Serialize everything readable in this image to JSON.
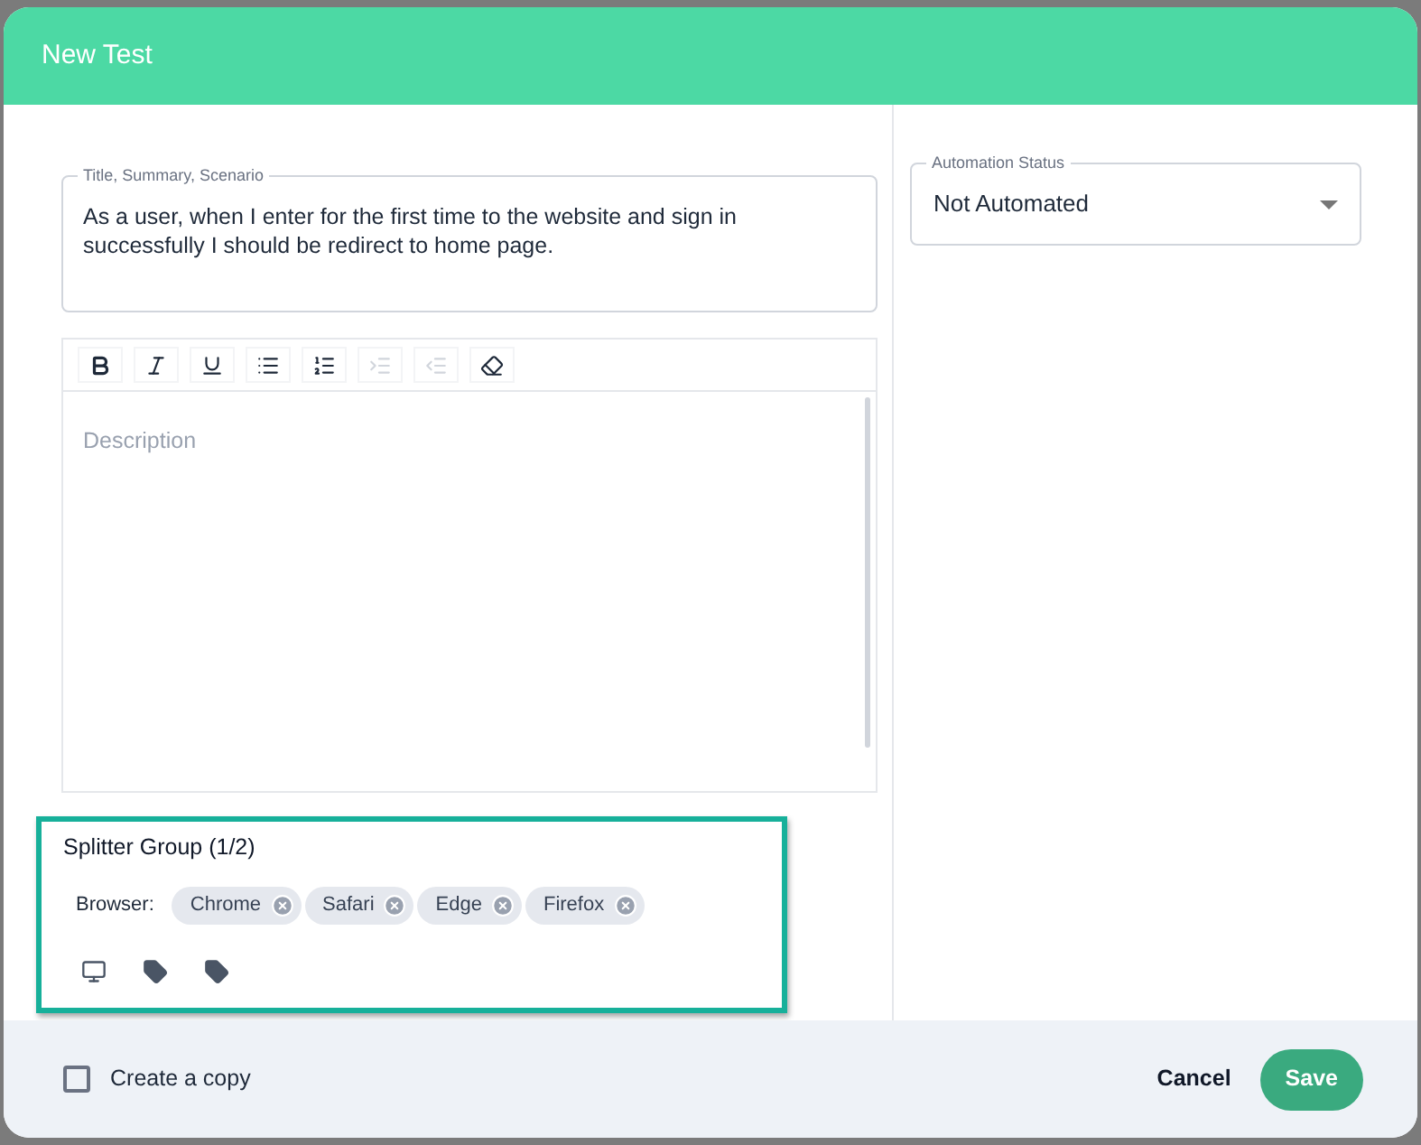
{
  "dialog": {
    "title": "New Test"
  },
  "title_field": {
    "label": "Title, Summary, Scenario",
    "value": "As a user, when I enter for the first time to the website and sign in successfully  I should be redirect to home page."
  },
  "toolbar": [
    {
      "kind": "bold",
      "disabled": false
    },
    {
      "kind": "italic",
      "disabled": false
    },
    {
      "kind": "underline",
      "disabled": false
    },
    {
      "kind": "bullets",
      "disabled": false
    },
    {
      "kind": "numbers",
      "disabled": false
    },
    {
      "kind": "indent",
      "disabled": true
    },
    {
      "kind": "outdent",
      "disabled": true
    },
    {
      "kind": "eraser",
      "disabled": false
    }
  ],
  "description": {
    "placeholder": "Description"
  },
  "splitter_group": {
    "title": "Splitter Group (1/2)",
    "label": "Browser:",
    "chips": [
      "Chrome",
      "Safari",
      "Edge",
      "Firefox"
    ],
    "icons": [
      {
        "kind": "monitor"
      },
      {
        "kind": "tag"
      },
      {
        "kind": "tag"
      }
    ]
  },
  "automation_status": {
    "label": "Automation Status",
    "value": "Not Automated"
  },
  "footer": {
    "checkbox": {
      "label": "Create a copy",
      "checked": false
    },
    "buttons": [
      {
        "label": "Cancel",
        "kind": "text"
      },
      {
        "label": "Save",
        "kind": "primary"
      }
    ]
  }
}
